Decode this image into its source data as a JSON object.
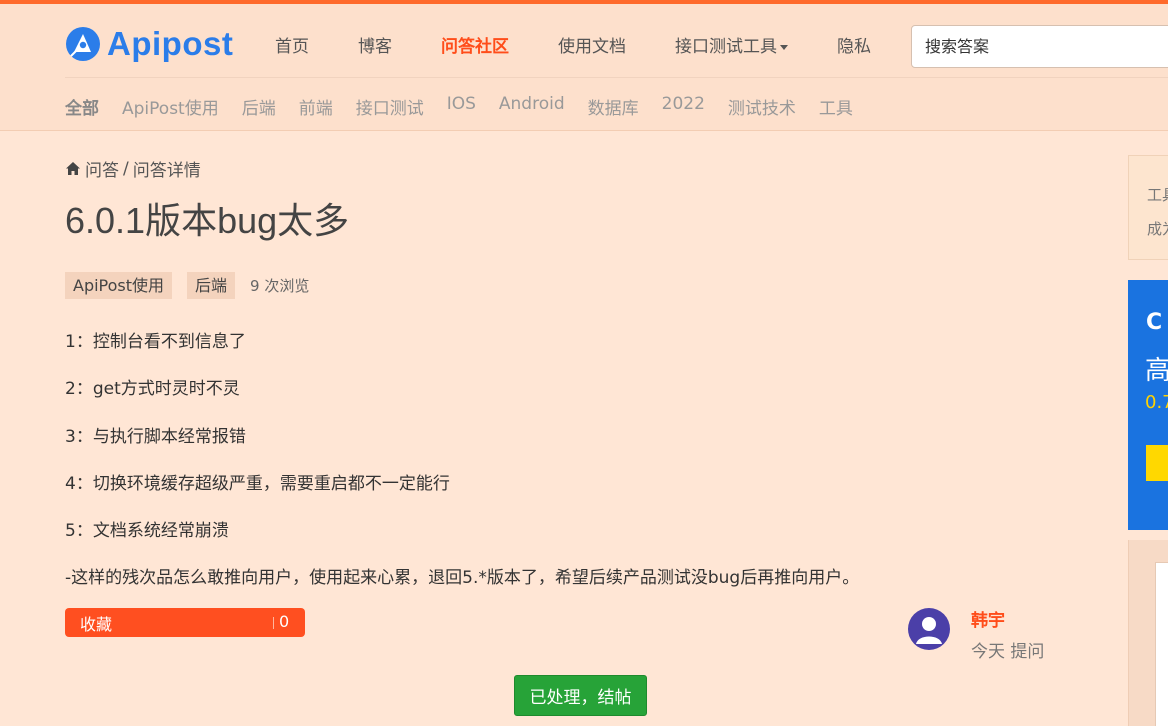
{
  "brand": {
    "name": "Apipost",
    "accent": "#ff4d1a",
    "logo_color": "#2b7de9"
  },
  "main_nav": [
    {
      "label": "首页",
      "active": false
    },
    {
      "label": "博客",
      "active": false
    },
    {
      "label": "问答社区",
      "active": true
    },
    {
      "label": "使用文档",
      "active": false
    },
    {
      "label": "接口测试工具",
      "active": false,
      "dropdown": true
    },
    {
      "label": "隐私",
      "active": false
    }
  ],
  "search": {
    "placeholder": "搜索答案",
    "value": ""
  },
  "sub_nav": [
    {
      "label": "全部",
      "active": true
    },
    {
      "label": "ApiPost使用",
      "active": false
    },
    {
      "label": "后端",
      "active": false
    },
    {
      "label": "前端",
      "active": false
    },
    {
      "label": "接口测试",
      "active": false
    },
    {
      "label": "IOS",
      "active": false
    },
    {
      "label": "Android",
      "active": false
    },
    {
      "label": "数据库",
      "active": false
    },
    {
      "label": "2022",
      "active": false
    },
    {
      "label": "测试技术",
      "active": false
    },
    {
      "label": "工具",
      "active": false
    }
  ],
  "breadcrumb": {
    "icon": "home-icon",
    "root": "问答",
    "separator": "/",
    "current": "问答详情"
  },
  "question": {
    "title": "6.0.1版本bug太多",
    "tags": [
      "ApiPost使用",
      "后端"
    ],
    "views": "9 次浏览",
    "lines": [
      "1：控制台看不到信息了",
      "2：get方式时灵时不灵",
      "3：与执行脚本经常报错",
      "4：切换环境缓存超级严重，需要重启都不一定能行",
      "5：文档系统经常崩溃",
      "-这样的残次品怎么敢推向用户，使用起来心累，退回5.*版本了，希望后续产品测试没bug后再推向用户。"
    ]
  },
  "favorite": {
    "label": "收藏",
    "count": "0",
    "color": "#ff4f20"
  },
  "author": {
    "name": "韩宇",
    "meta": "今天 提问",
    "avatar_icon": "user-avatar-icon"
  },
  "resolve": {
    "label": "已处理，结帖",
    "color": "#27a338"
  },
  "sidebar_partial": {
    "card_lines": [
      "工具",
      "成为"
    ],
    "banner_logo": "C",
    "banner_big": "高",
    "banner_small": "0.7"
  }
}
